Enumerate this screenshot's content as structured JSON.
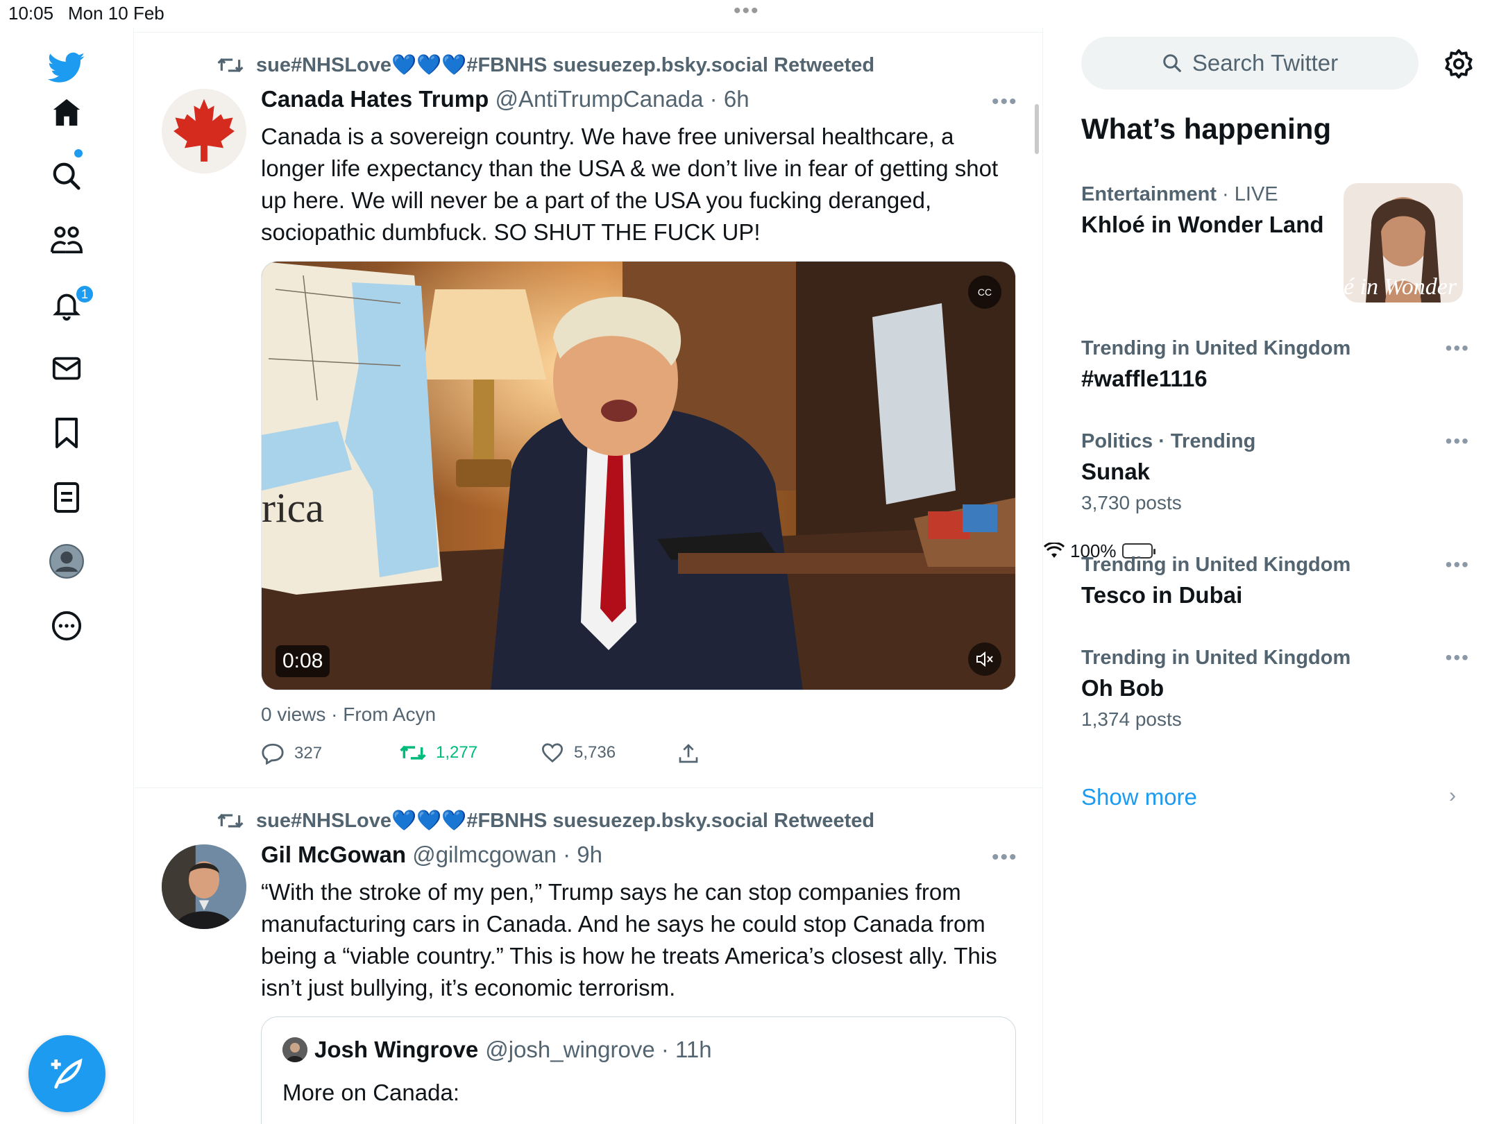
{
  "status_bar": {
    "time": "10:05",
    "date": "Mon 10 Feb",
    "battery": "100%"
  },
  "nav": {
    "notifications_badge": "1"
  },
  "tweets": [
    {
      "retweeted_by": "sue#NHSLove💙💙💙#FBNHS suesuezep.bsky.social Retweeted",
      "name": "Canada Hates Trump",
      "handle_time": "@AntiTrumpCanada · 6h",
      "text": "Canada is a sovereign country. We have free universal healthcare, a longer life expectancy than the USA & we don’t live in fear of getting shot up here. We will never be a part of the USA you fucking deranged, sociopathic dumbfuck. SO SHUT THE FUCK UP!",
      "video_duration": "0:08",
      "video_map_text": "rica",
      "cc_label": "CC",
      "views": "0 views · From Acyn",
      "replies": "327",
      "retweets": "1,277",
      "likes": "5,736"
    },
    {
      "retweeted_by": "sue#NHSLove💙💙💙#FBNHS suesuezep.bsky.social Retweeted",
      "name": "Gil McGowan",
      "handle_time": "@gilmcgowan · 9h",
      "text": "“With the stroke of my pen,” Trump says he can stop companies from manufacturing cars in Canada. And he says he could stop Canada from being a “viable country.” This is how he treats America’s closest ally. This isn’t just bullying, it’s economic terrorism.",
      "quote": {
        "name": "Josh Wingrove",
        "handle_time": "@josh_wingrove · 11h",
        "text": "More on Canada:"
      }
    }
  ],
  "sidebar": {
    "search_placeholder": "Search Twitter",
    "title": "What’s happening",
    "featured": {
      "category": "Entertainment",
      "live": "· LIVE",
      "topic": "Khloé in Wonder Land",
      "image_text": "é in Wonder L"
    },
    "trends": [
      {
        "meta": "Trending in United Kingdom",
        "topic": "#waffle1116",
        "count": ""
      },
      {
        "meta": "Politics · Trending",
        "topic": "Sunak",
        "count": "3,730 posts"
      },
      {
        "meta": "Trending in United Kingdom",
        "topic": "Tesco in Dubai",
        "count": ""
      },
      {
        "meta": "Trending in United Kingdom",
        "topic": "Oh Bob",
        "count": "1,374 posts"
      }
    ],
    "show_more": "Show more"
  },
  "colors": {
    "accent": "#1d9bf0",
    "retweet": "#00ba7c",
    "muted": "#536471"
  }
}
